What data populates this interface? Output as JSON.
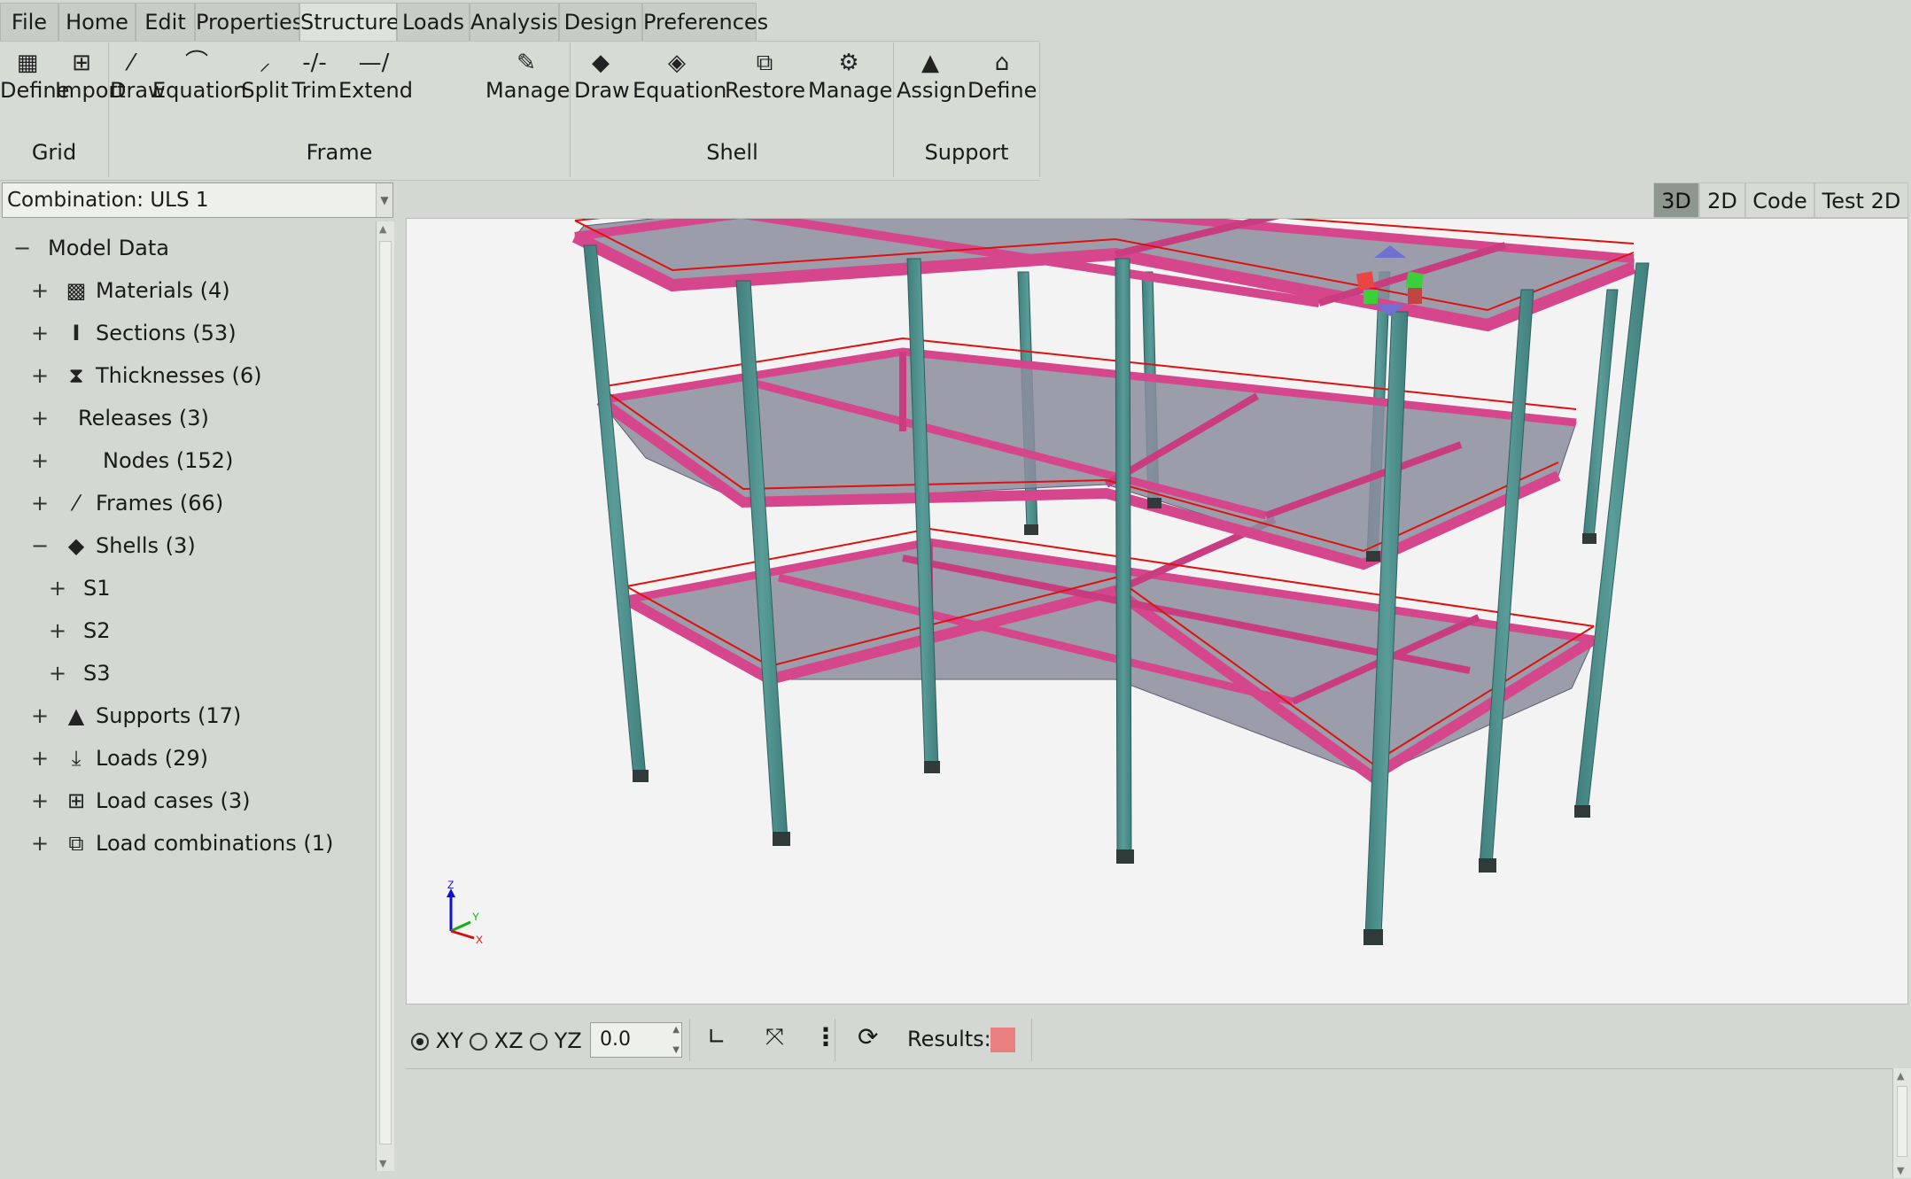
{
  "menu_tabs": [
    {
      "label": "File",
      "active": false
    },
    {
      "label": "Home",
      "active": false
    },
    {
      "label": "Edit",
      "active": false
    },
    {
      "label": "Properties",
      "active": false
    },
    {
      "label": "Structure",
      "active": true
    },
    {
      "label": "Loads",
      "active": false
    },
    {
      "label": "Analysis",
      "active": false
    },
    {
      "label": "Design",
      "active": false
    },
    {
      "label": "Preferences",
      "active": false
    }
  ],
  "ribbon": {
    "groups": {
      "grid": {
        "label": "Grid",
        "buttons": [
          {
            "label": "Define",
            "icon": "grid-icon"
          },
          {
            "label": "Import",
            "icon": "grid-import-icon"
          }
        ]
      },
      "frame": {
        "label": "Frame",
        "buttons": [
          {
            "label": "Draw",
            "icon": "frame-draw-icon"
          },
          {
            "label": "Equation",
            "icon": "frame-equation-icon"
          },
          {
            "label": "Split",
            "icon": "frame-split-icon"
          },
          {
            "label": "Trim",
            "icon": "trim-icon"
          },
          {
            "label": "Extend",
            "icon": "extend-icon"
          },
          {
            "label": "Manage",
            "icon": "frame-manage-icon"
          }
        ]
      },
      "shell": {
        "label": "Shell",
        "buttons": [
          {
            "label": "Draw",
            "icon": "shell-draw-icon"
          },
          {
            "label": "Equation",
            "icon": "shell-equation-icon"
          },
          {
            "label": "Restore",
            "icon": "shell-restore-icon"
          },
          {
            "label": "Manage",
            "icon": "shell-manage-icon"
          }
        ]
      },
      "support": {
        "label": "Support",
        "buttons": [
          {
            "label": "Assign",
            "icon": "support-assign-icon"
          },
          {
            "label": "Define",
            "icon": "support-define-icon"
          }
        ]
      }
    }
  },
  "combination": {
    "value": "Combination: ULS 1"
  },
  "tree": {
    "root": {
      "label": "Model Data",
      "expander": "−"
    },
    "items": [
      {
        "label": "Materials (4)",
        "expander": "+",
        "icon": "materials-icon"
      },
      {
        "label": "Sections (53)",
        "expander": "+",
        "icon": "sections-icon"
      },
      {
        "label": "Thicknesses (6)",
        "expander": "+",
        "icon": "thicknesses-icon"
      },
      {
        "label": "Releases (3)",
        "expander": "+",
        "icon": ""
      },
      {
        "label": "Nodes (152)",
        "expander": "+",
        "icon": ""
      },
      {
        "label": "Frames (66)",
        "expander": "+",
        "icon": "frames-icon"
      },
      {
        "label": "Shells (3)",
        "expander": "−",
        "icon": "shells-icon"
      },
      {
        "label": "S1",
        "expander": "+",
        "icon": ""
      },
      {
        "label": "S2",
        "expander": "+",
        "icon": ""
      },
      {
        "label": "S3",
        "expander": "+",
        "icon": ""
      },
      {
        "label": "Supports (17)",
        "expander": "+",
        "icon": "supports-icon"
      },
      {
        "label": "Loads (29)",
        "expander": "+",
        "icon": "loads-icon"
      },
      {
        "label": "Load cases (3)",
        "expander": "+",
        "icon": "load-cases-icon"
      },
      {
        "label": "Load combinations (1)",
        "expander": "+",
        "icon": "load-combinations-icon"
      }
    ]
  },
  "view_tabs": [
    {
      "label": "3D",
      "active": true
    },
    {
      "label": "2D",
      "active": false
    },
    {
      "label": "Code",
      "active": false
    },
    {
      "label": "Test 2D",
      "active": false
    }
  ],
  "axes_labels": {
    "z": "Z",
    "y": "Y",
    "x": "X"
  },
  "colors": {
    "column": "#4f8f8c",
    "beam": "#d6468c",
    "slab": "#8c8d9f",
    "railing": "#e01010",
    "result_swatch": "#ea7f7f"
  },
  "toolbar": {
    "planes": [
      {
        "label": "XY",
        "selected": true
      },
      {
        "label": "XZ",
        "selected": false
      },
      {
        "label": "YZ",
        "selected": false
      }
    ],
    "level_value": "0.0",
    "results_label": "Results:"
  }
}
